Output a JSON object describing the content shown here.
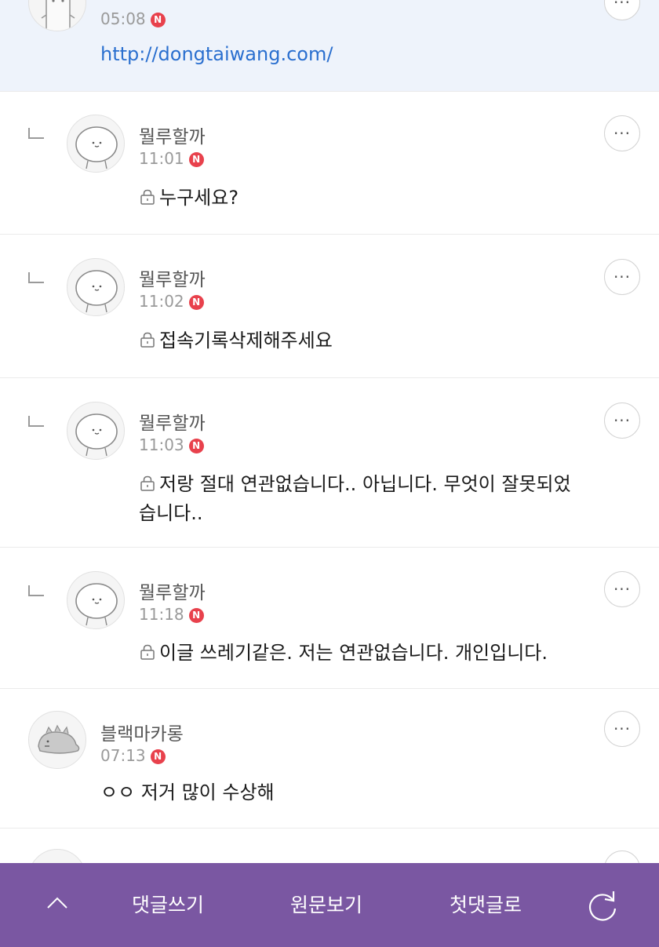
{
  "comments": [
    {
      "name": "",
      "time": "05:08",
      "badge": "N",
      "link": "http://dongtaiwang.com/",
      "avatar": "ghost-avatar"
    },
    {
      "name": "뭘루할까",
      "time": "11:01",
      "badge": "N",
      "secret": true,
      "text": "누구세요?",
      "avatar": "round-face-avatar"
    },
    {
      "name": "뭘루할까",
      "time": "11:02",
      "badge": "N",
      "secret": true,
      "text": "접속기록삭제해주세요",
      "avatar": "round-face-avatar"
    },
    {
      "name": "뭘루할까",
      "time": "11:03",
      "badge": "N",
      "secret": true,
      "text_line1": "저랑 절대 연관없습니다.. 아닙니다. 무엇이 잘못되었",
      "text_line2": "습니다..",
      "avatar": "round-face-avatar"
    },
    {
      "name": "뭘루할까",
      "time": "11:18",
      "badge": "N",
      "secret": true,
      "text": "이글 쓰레기같은. 저는 연관없습니다. 개인입니다.",
      "avatar": "round-face-avatar"
    },
    {
      "name": "블랙마카롱",
      "time": "07:13",
      "badge": "N",
      "text": "ㅇㅇ 저거 많이 수상해",
      "avatar": "dino-avatar"
    }
  ],
  "more_label": "···",
  "bottom_bar": {
    "write_comment": "댓글쓰기",
    "view_original": "원문보기",
    "first_comment": "첫댓글로",
    "icons": [
      "chevron-up-icon",
      "refresh-icon"
    ]
  },
  "colors": {
    "accent_bar": "#7a57a2",
    "new_badge": "#e8414c",
    "link": "#2a6fcf",
    "highlight_bg": "#eef3fb"
  }
}
